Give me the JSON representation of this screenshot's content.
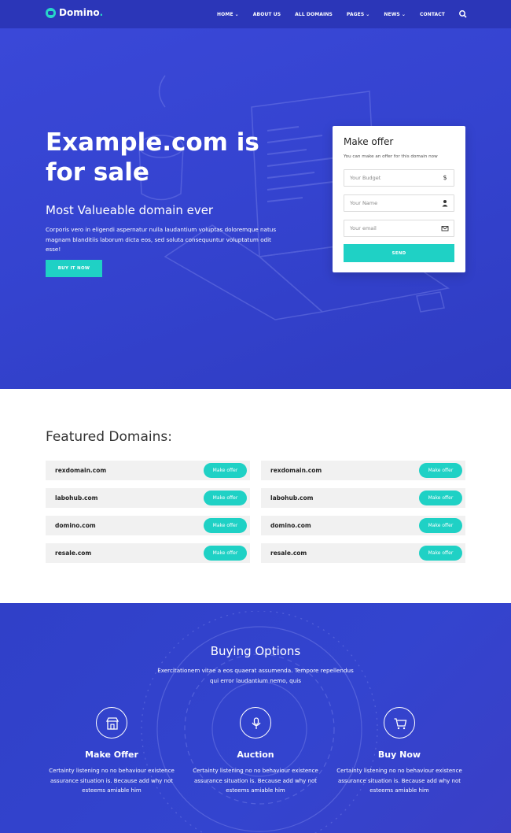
{
  "brand": {
    "name": "Domino",
    "dot": "."
  },
  "nav": {
    "items": [
      {
        "label": "HOME",
        "has_dropdown": true
      },
      {
        "label": "ABOUT US",
        "has_dropdown": false
      },
      {
        "label": "ALL DOMAINS",
        "has_dropdown": false
      },
      {
        "label": "PAGES",
        "has_dropdown": true
      },
      {
        "label": "NEWS",
        "has_dropdown": true
      },
      {
        "label": "CONTACT",
        "has_dropdown": false
      }
    ],
    "search_icon": "search-icon"
  },
  "hero": {
    "title": "Example.com is for sale",
    "subtitle": "Most Valueable domain ever",
    "paragraph": "Corporis vero in eligendi aspernatur nulla laudantium voluptas doloremque natus magnam blanditiis laborum dicta eos, sed soluta consequuntur voluptatum odit esse!",
    "button": "BUY IT NOW"
  },
  "offer_form": {
    "title": "Make offer",
    "subtitle": "You can make an offer for this domain now",
    "fields": [
      {
        "placeholder": "Your Budget",
        "icon": "dollar-icon"
      },
      {
        "placeholder": "Your Name",
        "icon": "user-icon"
      },
      {
        "placeholder": "Your email",
        "icon": "envelope-icon"
      }
    ],
    "submit": "SEND"
  },
  "featured": {
    "title": "Featured Domains:",
    "button_label": "Make offer",
    "left": [
      "rexdomain.com",
      "labohub.com",
      "domino.com",
      "resale.com"
    ],
    "right": [
      "rexdomain.com",
      "labohub.com",
      "domino.com",
      "resale.com"
    ]
  },
  "buying": {
    "title": "Buying Options",
    "description": "Exercitationem vitae a eos quaerat assumenda. Tempore repellendus qui error laudantium nemo, quis",
    "options": [
      {
        "title": "Make Offer",
        "text": "Certainty listening no no behaviour existence assurance situation is. Because add why not esteems amiable him",
        "icon": "storefront-icon"
      },
      {
        "title": "Auction",
        "text": "Certainty listening no no behaviour existence assurance situation is. Because add why not esteems amiable him",
        "icon": "microphone-icon"
      },
      {
        "title": "Buy Now",
        "text": "Certainty listening no no behaviour existence assurance situation is. Because add why not esteems amiable him",
        "icon": "cart-icon"
      }
    ]
  },
  "colors": {
    "primary_blue": "#3443cf",
    "nav_blue": "#2b36b8",
    "accent_teal": "#1fd1c5"
  }
}
